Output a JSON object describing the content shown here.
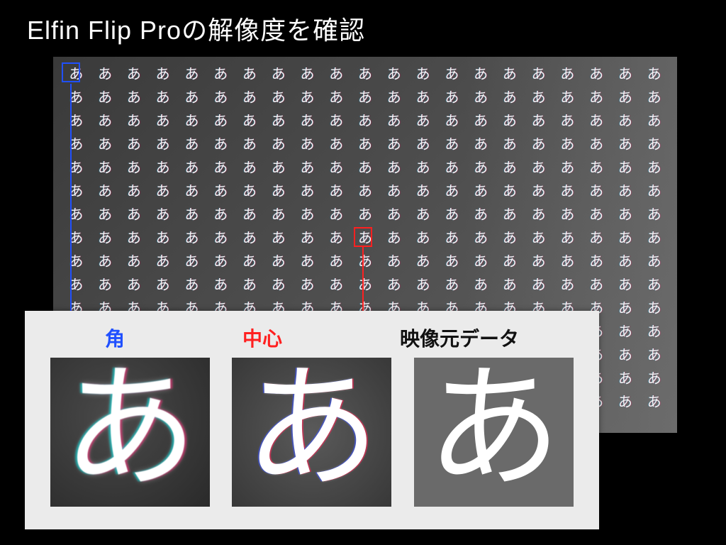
{
  "title": "Elfin Flip Proの解像度を確認",
  "grid": {
    "rows": 15,
    "cols": 21,
    "char": "あ"
  },
  "panel": {
    "labels": {
      "corner": "角",
      "center": "中心",
      "source": "映像元データ"
    },
    "glyph": "あ"
  }
}
